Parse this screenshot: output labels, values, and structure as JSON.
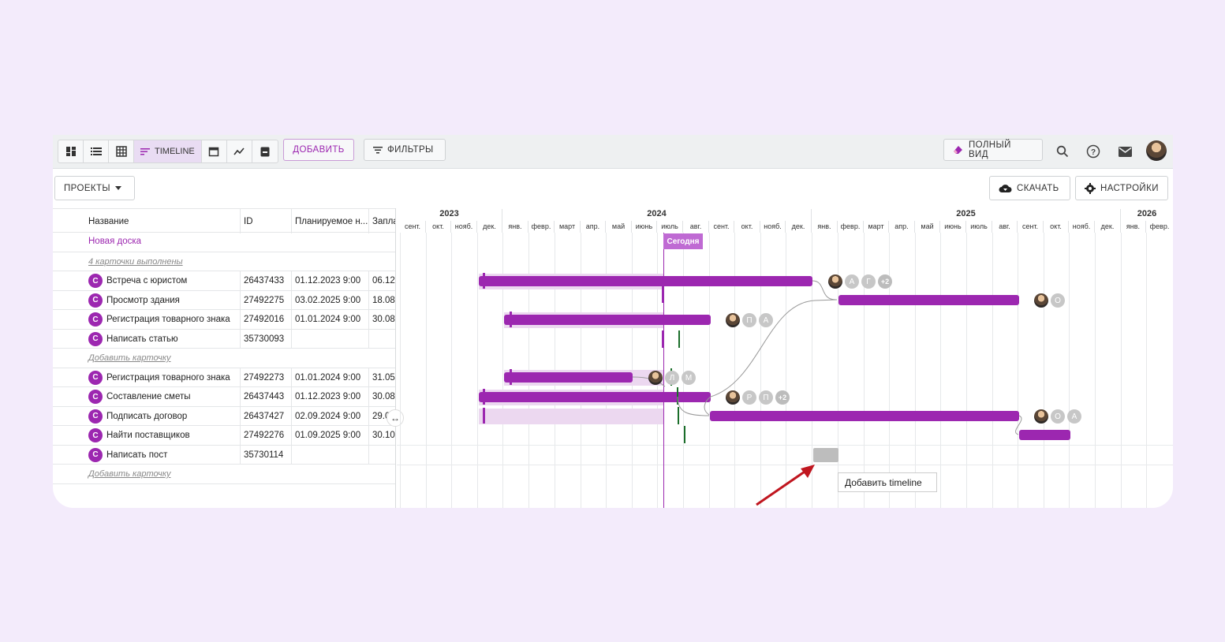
{
  "toolbar": {
    "views": [
      "board-view-icon",
      "list-view-icon",
      "table-view-icon",
      "timeline-view-icon",
      "calendar-view-icon",
      "chart-view-icon",
      "archive-view-icon"
    ],
    "timeline_label": "TIMELINE",
    "add_label": "ДОБАВИТЬ",
    "filters_label": "ФИЛЬТРЫ",
    "fullview_label": "ПОЛНЫЙ ВИД"
  },
  "toolbar2": {
    "projects_label": "ПРОЕКТЫ",
    "download_label": "СКАЧАТЬ",
    "settings_label": "НАСТРОЙКИ"
  },
  "table": {
    "headers": [
      "Название",
      "ID",
      "Планируемое н...",
      "Запла"
    ],
    "board_name": "Новая доска",
    "done_link": "4 карточки выполнены",
    "add_card": "Добавить карточку",
    "rows_a": [
      {
        "icon": "С",
        "name": "Встреча с юристом",
        "id": "26437433",
        "start": "01.12.2023 9:00",
        "end": "06.12"
      },
      {
        "icon": "С",
        "name": "Просмотр здания",
        "id": "27492275",
        "start": "03.02.2025 9:00",
        "end": "18.08"
      },
      {
        "icon": "С",
        "name": "Регистрация товарного знака",
        "id": "27492016",
        "start": "01.01.2024 9:00",
        "end": "30.08"
      },
      {
        "icon": "С",
        "name": "Написать статью",
        "id": "35730093",
        "start": "",
        "end": ""
      }
    ],
    "rows_b": [
      {
        "icon": "С",
        "name": "Регистрация товарного знака",
        "id": "27492273",
        "start": "01.01.2024 9:00",
        "end": "31.05"
      },
      {
        "icon": "С",
        "name": "Составление сметы",
        "id": "26437443",
        "start": "01.12.2023 9:00",
        "end": "30.08"
      },
      {
        "icon": "С",
        "name": "Подписать договор",
        "id": "26437427",
        "start": "02.09.2024 9:00",
        "end": "29.0"
      },
      {
        "icon": "С",
        "name": "Найти поставщиков",
        "id": "27492276",
        "start": "01.09.2025 9:00",
        "end": "30.10"
      },
      {
        "icon": "С",
        "name": "Написать пост",
        "id": "35730114",
        "start": "",
        "end": ""
      }
    ]
  },
  "timeline": {
    "years": [
      "2023",
      "2024",
      "2025",
      "2026"
    ],
    "months_2023": [
      "сент.",
      "окт.",
      "нояб.",
      "дек."
    ],
    "months_2024": [
      "янв.",
      "февр.",
      "март",
      "апр.",
      "май",
      "июнь",
      "июль",
      "авг.",
      "сент.",
      "окт.",
      "нояб.",
      "дек."
    ],
    "months_2025": [
      "янв.",
      "февр.",
      "март",
      "апр.",
      "май",
      "июнь",
      "июль",
      "авг.",
      "сент.",
      "окт.",
      "нояб.",
      "дек."
    ],
    "months_2026": [
      "янв.",
      "февр."
    ],
    "today_label": "Сегодня",
    "tooltip": "Добавить timeline",
    "avatars": {
      "row1": [
        "А",
        "Г",
        "+2"
      ],
      "row2": [
        "О"
      ],
      "row3": [
        "П",
        "А"
      ],
      "row6": [
        "Л",
        "М"
      ],
      "row7": [
        "Р",
        "П",
        "+2"
      ],
      "row8": [
        "О",
        "А"
      ]
    }
  },
  "colors": {
    "accent": "#9c27b0",
    "background": "#f3ebfb",
    "green_marker": "#1b6e2a"
  }
}
